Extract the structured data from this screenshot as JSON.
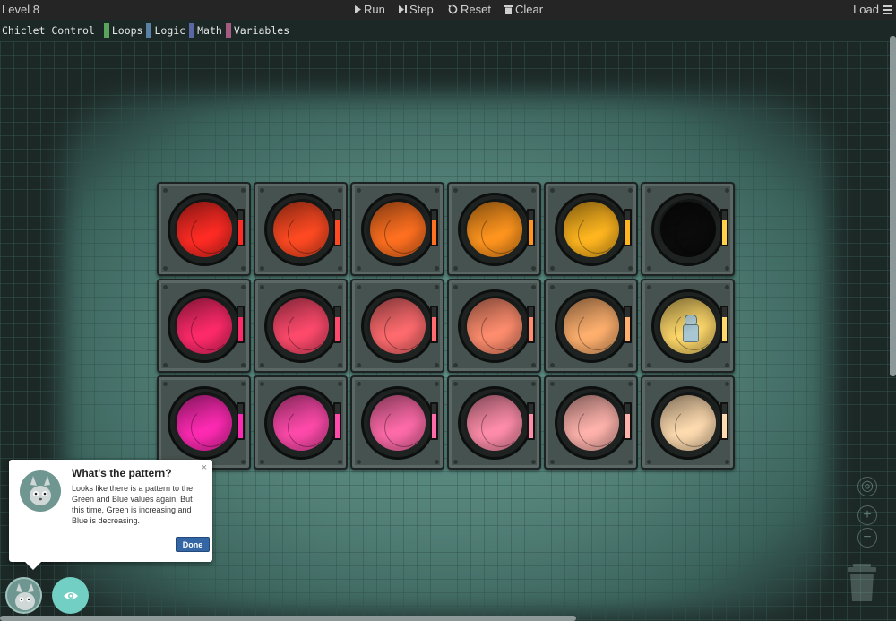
{
  "toolbar": {
    "level": "Level 8",
    "run": "Run",
    "step": "Step",
    "reset": "Reset",
    "clear": "Clear",
    "load": "Load"
  },
  "categories": [
    {
      "label": "Chiclet Control",
      "color": ""
    },
    {
      "label": "Loops",
      "color": "#5ba55b"
    },
    {
      "label": "Logic",
      "color": "#5b80a5"
    },
    {
      "label": "Math",
      "color": "#5b67a5"
    },
    {
      "label": "Variables",
      "color": "#a55b80"
    }
  ],
  "grid": {
    "rows": [
      [
        "#ff2b24",
        "#ff4a22",
        "#ff7020",
        "#ff951e",
        "#ffb61f",
        "#0b0b0b"
      ],
      [
        "#ff2a6a",
        "#ff4a6c",
        "#ff6b6e",
        "#ff8d6e",
        "#ffb06e",
        "#ffd96a"
      ],
      [
        "#ff2ab3",
        "#ff4aab",
        "#ff6ba9",
        "#ff8daa",
        "#ffb3ac",
        "#ffdcb0"
      ]
    ],
    "robot_cell": [
      1,
      5
    ]
  },
  "popup": {
    "title": "What's the pattern?",
    "body": "Looks like there is a pattern to the Green and Blue values again. But this time, Green is increasing and Blue is decreasing.",
    "close": "×",
    "done": "Done"
  },
  "controls": {
    "recenter": "◎",
    "zoom_in": "+",
    "zoom_out": "−"
  }
}
